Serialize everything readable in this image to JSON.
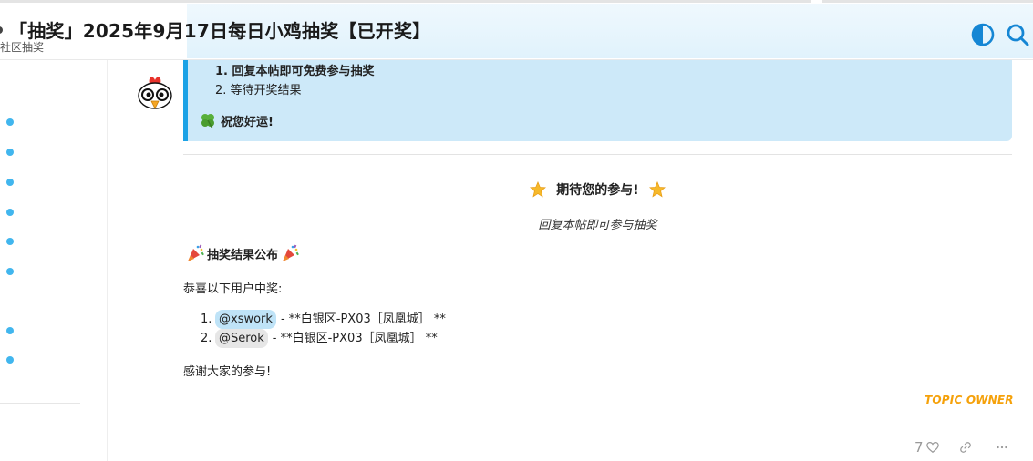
{
  "header": {
    "title": "「抽奖」2025年9月17日每日小鸡抽奖【已开奖】",
    "category": "社区抽奖",
    "theme_icon": "half-circle-contrast-icon",
    "search_icon": "search-icon"
  },
  "post": {
    "callout": {
      "steps": [
        "1. 回复本帖即可免费参与抽奖",
        "2. 等待开奖结果"
      ],
      "luck": "祝您好运!"
    },
    "expect_title": "期待您的参与!",
    "expect_sub": "回复本帖即可参与抽奖",
    "result_title": "抽奖结果公布",
    "congrats": "恭喜以下用户中奖:",
    "winners": [
      {
        "num": "1.",
        "user": "@xswork",
        "prize": "- **白银区-PX03［凤凰城］ **"
      },
      {
        "num": "2.",
        "user": "@Serok",
        "prize": "- **白银区-PX03［凤凰城］ **"
      }
    ],
    "thanks": "感谢大家的参与!",
    "owner_badge": "TOPIC OWNER",
    "likes": "7"
  },
  "colors": {
    "accent": "#1ba2e6",
    "callout_bg": "#cde9f9",
    "owner": "#f5a10a",
    "sidebar_dot": "#41b6ee"
  }
}
